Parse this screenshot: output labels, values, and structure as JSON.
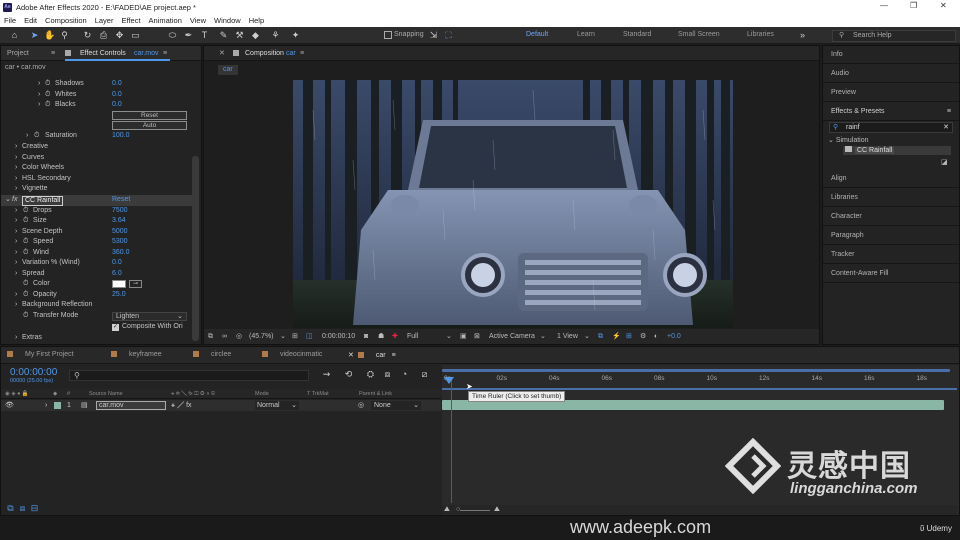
{
  "window": {
    "title": "Adobe After Effects 2020 - E:\\FADED\\AE project.aep *",
    "app_badge": "Ae"
  },
  "menu": [
    "File",
    "Edit",
    "Composition",
    "Layer",
    "Effect",
    "Animation",
    "View",
    "Window",
    "Help"
  ],
  "toolbar": {
    "snapping_label": "Snapping",
    "workspaces": [
      "Default",
      "Learn",
      "Standard",
      "Small Screen",
      "Libraries"
    ],
    "active_workspace": "Default",
    "search_placeholder": "Search Help"
  },
  "effect_controls": {
    "project_tab": "Project",
    "tab_label": "Effect Controls",
    "tab_target": "car.mov",
    "breadcrumb": "car • car.mov",
    "rows": [
      {
        "label": "Shadows",
        "value": "0.0"
      },
      {
        "label": "Whites",
        "value": "0.0"
      },
      {
        "label": "Blacks",
        "value": "0.0"
      }
    ],
    "reset_label": "Reset",
    "auto_label": "Auto",
    "saturation": {
      "label": "Saturation",
      "value": "100.0"
    },
    "groups": [
      "Creative",
      "Curves",
      "Color Wheels",
      "HSL Secondary",
      "Vignette"
    ],
    "effect_name": "CC Rainfall",
    "effect_reset": "Reset",
    "props": [
      {
        "label": "Drops",
        "value": "7500"
      },
      {
        "label": "Size",
        "value": "3.64"
      },
      {
        "label": "Scene Depth",
        "value": "5000"
      },
      {
        "label": "Speed",
        "value": "5300"
      },
      {
        "label": "Wind",
        "value": "360.0"
      },
      {
        "label": "Variation % (Wind)",
        "value": "0.0"
      },
      {
        "label": "Spread",
        "value": "6.0"
      },
      {
        "label": "Color",
        "value": ""
      },
      {
        "label": "Opacity",
        "value": "25.0"
      },
      {
        "label": "Background Reflection",
        "value": ""
      },
      {
        "label": "Transfer Mode",
        "value": "Lighten"
      },
      {
        "label": "",
        "value": "Composite With Ori"
      },
      {
        "label": "Extras",
        "value": ""
      }
    ]
  },
  "composition": {
    "tab_label": "Composition",
    "tab_target": "car",
    "breadcrumb": "car",
    "zoom": "(45.7%)",
    "timecode": "0:00:00:10",
    "resolution": "Full",
    "camera": "Active Camera",
    "views": "1 View",
    "exposure": "+0.0"
  },
  "right_panel": {
    "items": [
      "Info",
      "Audio",
      "Preview"
    ],
    "effects_presets": "Effects & Presets",
    "search_value": "rainf",
    "category": "Simulation",
    "result": "CC Rainfall",
    "lower_items": [
      "Align",
      "Libraries",
      "Character",
      "Paragraph",
      "Tracker",
      "Content-Aware Fill"
    ]
  },
  "timeline": {
    "tabs": [
      {
        "label": "My First Project",
        "color": "#b07a4a"
      },
      {
        "label": "keyframee",
        "color": "#b07a4a"
      },
      {
        "label": "circlee",
        "color": "#b07a4a"
      },
      {
        "label": "videocinmatic",
        "color": "#b07a4a"
      },
      {
        "label": "car",
        "color": "#b07a4a"
      }
    ],
    "timecode": "0:00:00:00",
    "frame_info": "00000 (25.00 fps)",
    "search_placeholder": "",
    "columns": {
      "source_name": "Source Name",
      "mode": "Mode",
      "trkmat": "T  TrkMat",
      "parent": "Parent & Link"
    },
    "layer": {
      "index": "1",
      "name": "car.mov",
      "mode": "Normal",
      "parent": "None"
    },
    "ruler": [
      "0s",
      "02s",
      "04s",
      "06s",
      "08s",
      "10s",
      "12s",
      "14s",
      "16s",
      "18s"
    ],
    "tooltip": "Time Ruler (Click to set thumb)"
  },
  "watermarks": {
    "brand_cn": "灵感中国",
    "brand_url": "lingganchina.com",
    "site": "www.adeepk.com",
    "udemy": "Udemy"
  },
  "colors": {
    "accent": "#4f97e8",
    "layer_bar": "#8ab6a6",
    "playhead": "#c03030"
  }
}
